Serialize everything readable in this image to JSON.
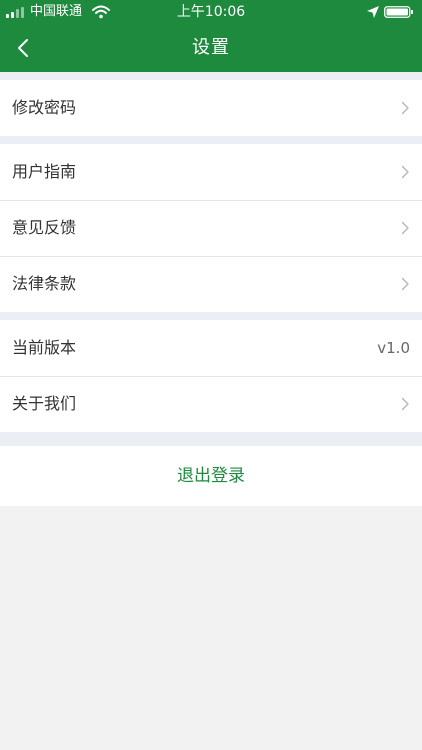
{
  "status_bar": {
    "carrier": "中国联通",
    "time": "上午10:06"
  },
  "nav": {
    "title": "设置"
  },
  "sections": {
    "account": {
      "change_password": "修改密码"
    },
    "help": {
      "user_guide": "用户指南",
      "feedback": "意见反馈",
      "legal_terms": "法律条款"
    },
    "about": {
      "current_version_label": "当前版本",
      "current_version_value": "v1.0",
      "about_us": "关于我们"
    }
  },
  "logout_label": "退出登录",
  "colors": {
    "brand_green": "#1e8a3e",
    "section_gap": "#eceef6",
    "page_background": "#f2f2f2"
  },
  "icons": {
    "back": "chevron-left-icon",
    "row_arrow": "chevron-right-icon",
    "wifi": "wifi-icon",
    "location": "location-arrow-icon",
    "battery": "battery-icon",
    "signal": "signal-bars-icon"
  }
}
